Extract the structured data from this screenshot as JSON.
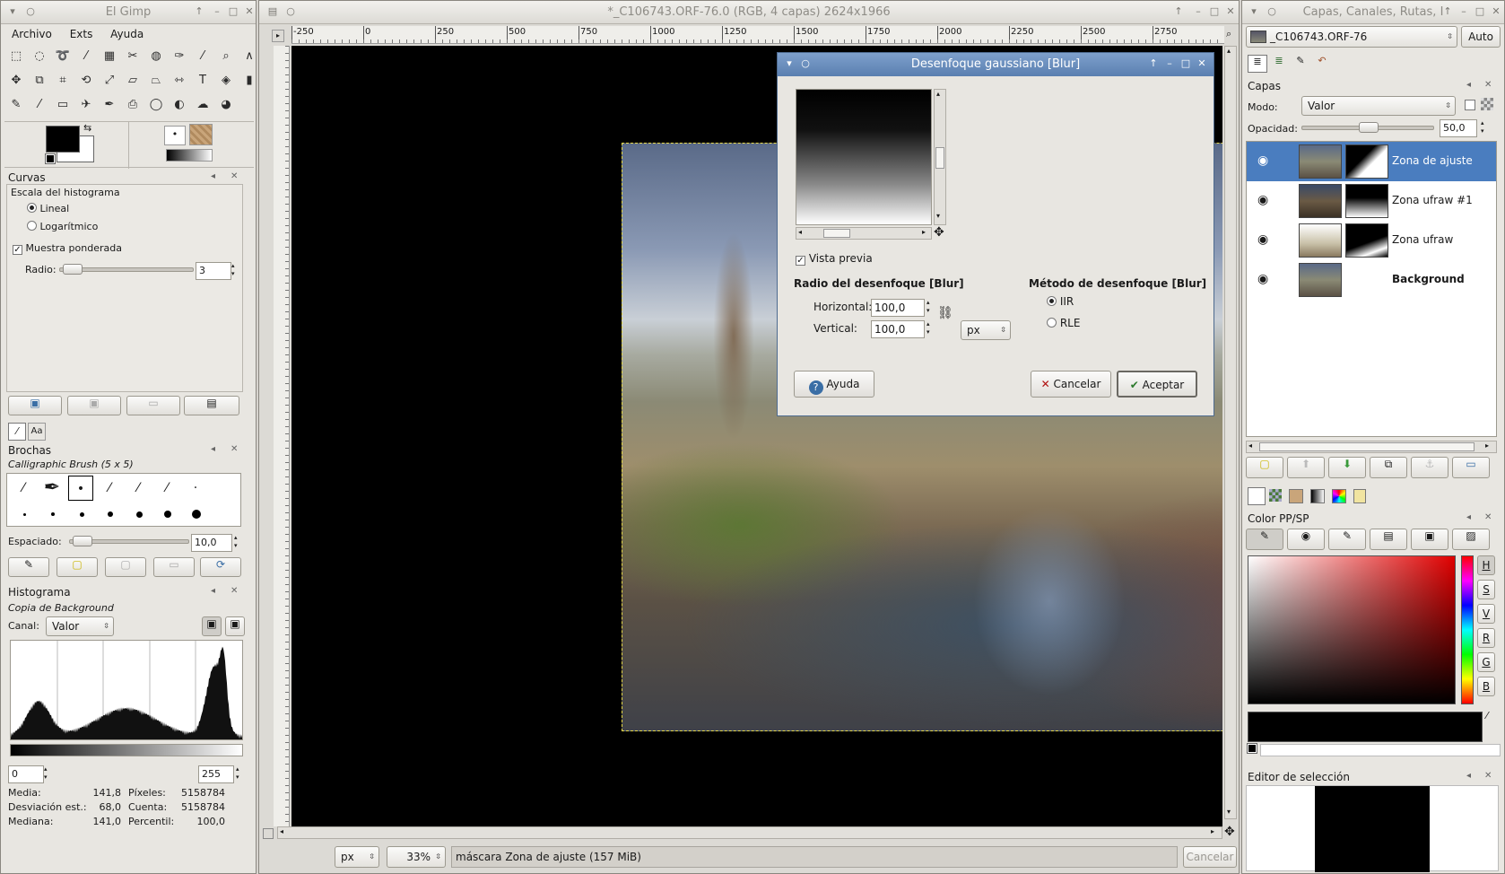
{
  "toolbox": {
    "title": "El Gimp",
    "menu": [
      "Archivo",
      "Exts",
      "Ayuda"
    ],
    "curves": {
      "title": "Curvas",
      "hist_scale_label": "Escala del histograma",
      "linear": "Lineal",
      "log": "Logarítmico",
      "weighted": "Muestra ponderada",
      "radius_label": "Radio:",
      "radius_value": "3"
    },
    "brushes": {
      "title": "Brochas",
      "brush_name": "Calligraphic Brush (5 x 5)",
      "spacing_label": "Espaciado:",
      "spacing_value": "10,0"
    },
    "histogram": {
      "title": "Histograma",
      "source": "Copia de Background",
      "channel_label": "Canal:",
      "channel_value": "Valor",
      "range_min": "0",
      "range_max": "255",
      "stats": [
        {
          "label": "Media:",
          "value": "141,8",
          "label2": "Píxeles:",
          "value2": "5158784"
        },
        {
          "label": "Desviación est.:",
          "value": "68,0",
          "label2": "Cuenta:",
          "value2": "5158784"
        },
        {
          "label": "Mediana:",
          "value": "141,0",
          "label2": "Percentil:",
          "value2": "100,0"
        }
      ]
    }
  },
  "image_window": {
    "title": "*_C106743.ORF-76.0 (RGB, 4 capas) 2624x1966",
    "ruler_labels": [
      "-250",
      "0",
      "250",
      "500",
      "750",
      "1000",
      "1250",
      "1500",
      "1750",
      "2000",
      "2250",
      "2500",
      "2750"
    ],
    "status": {
      "unit": "px",
      "zoom": "33%",
      "message": "máscara Zona de ajuste  (157 MiB)",
      "cancel": "Cancelar"
    }
  },
  "blur_dialog": {
    "title": "Desenfoque gaussiano [Blur]",
    "preview_label": "Vista previa",
    "radius_section": "Radio del desenfoque [Blur]",
    "horizontal_label": "Horizontal:",
    "horizontal_value": "100,0",
    "vertical_label": "Vertical:",
    "vertical_value": "100,0",
    "unit": "px",
    "method_section": "Método de desenfoque [Blur]",
    "method_iir": "IIR",
    "method_rle": "RLE",
    "help_button": "Ayuda",
    "cancel_button": "Cancelar",
    "ok_button": "Aceptar"
  },
  "layers_window": {
    "title": "Capas, Canales, Rutas, I",
    "image_selector": "_C106743.ORF-76",
    "auto_button": "Auto",
    "layers_title": "Capas",
    "mode_label": "Modo:",
    "mode_value": "Valor",
    "opacity_label": "Opacidad:",
    "opacity_value": "50,0",
    "layers": [
      {
        "name": "Zona de ajuste",
        "selected": true
      },
      {
        "name": "Zona ufraw #1",
        "selected": false
      },
      {
        "name": "Zona ufraw",
        "selected": false
      },
      {
        "name": "Background",
        "selected": false,
        "bold": true
      }
    ],
    "color_title": "Color PP/SP",
    "color_channels": [
      "H",
      "S",
      "V",
      "R",
      "G",
      "B"
    ],
    "selection_editor_title": "Editor de selección"
  }
}
